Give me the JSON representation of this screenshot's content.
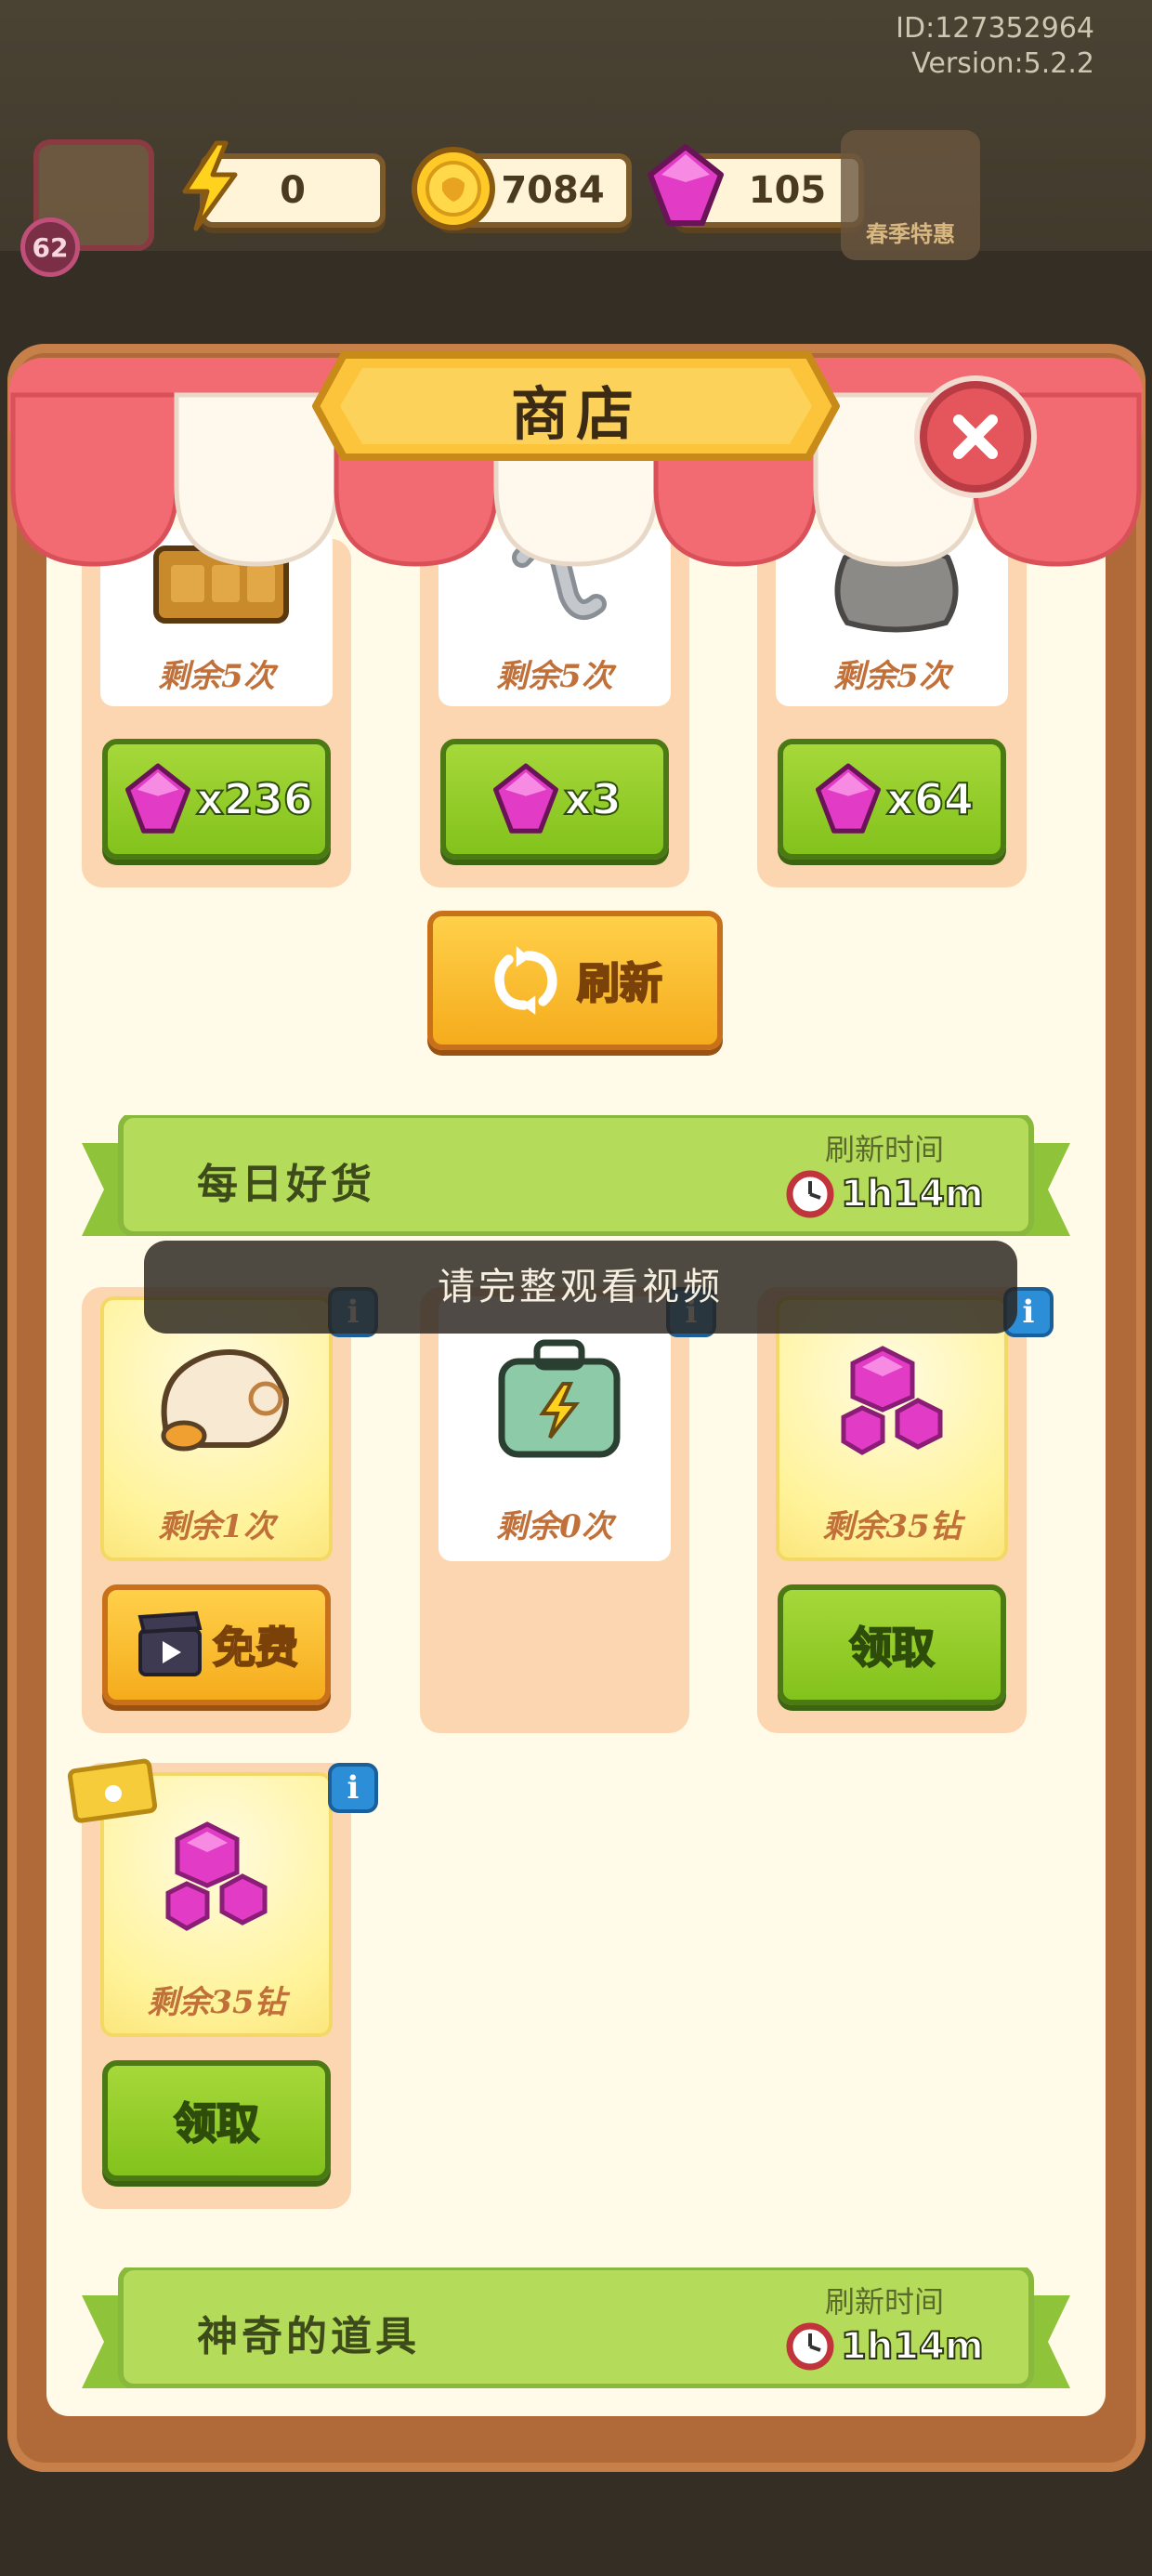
{
  "header": {
    "id_text": "ID:127352964",
    "version_text": "Version:5.2.2",
    "player_level": "62",
    "energy": "0",
    "coins": "7084",
    "gems": "105",
    "event_label": "春季特惠"
  },
  "shop": {
    "title": "商店",
    "top_row": [
      {
        "remain": "剩余5次",
        "price": "x236"
      },
      {
        "remain": "剩余5次",
        "price": "x3"
      },
      {
        "remain": "剩余5次",
        "price": "x64"
      }
    ],
    "refresh_label": "刷新",
    "daily": {
      "title": "每日好货",
      "refresh_time_label": "刷新时间",
      "timer": "1h14m",
      "items": [
        {
          "remain": "剩余1次",
          "button": "免费"
        },
        {
          "remain": "剩余0次",
          "button": ""
        },
        {
          "remain": "剩余35钻",
          "button": "领取"
        },
        {
          "remain": "剩余35钻",
          "button": "领取"
        }
      ]
    },
    "magic": {
      "title": "神奇的道具",
      "refresh_time_label": "刷新时间",
      "timer": "1h14m"
    },
    "toast": "请完整观看视频",
    "colors": {
      "awning_red": "#f0606a",
      "button_green": "#8bc820",
      "button_orange": "#f8bb28",
      "band_green": "#b4dc5a",
      "gem_pink": "#e23cc6"
    }
  }
}
